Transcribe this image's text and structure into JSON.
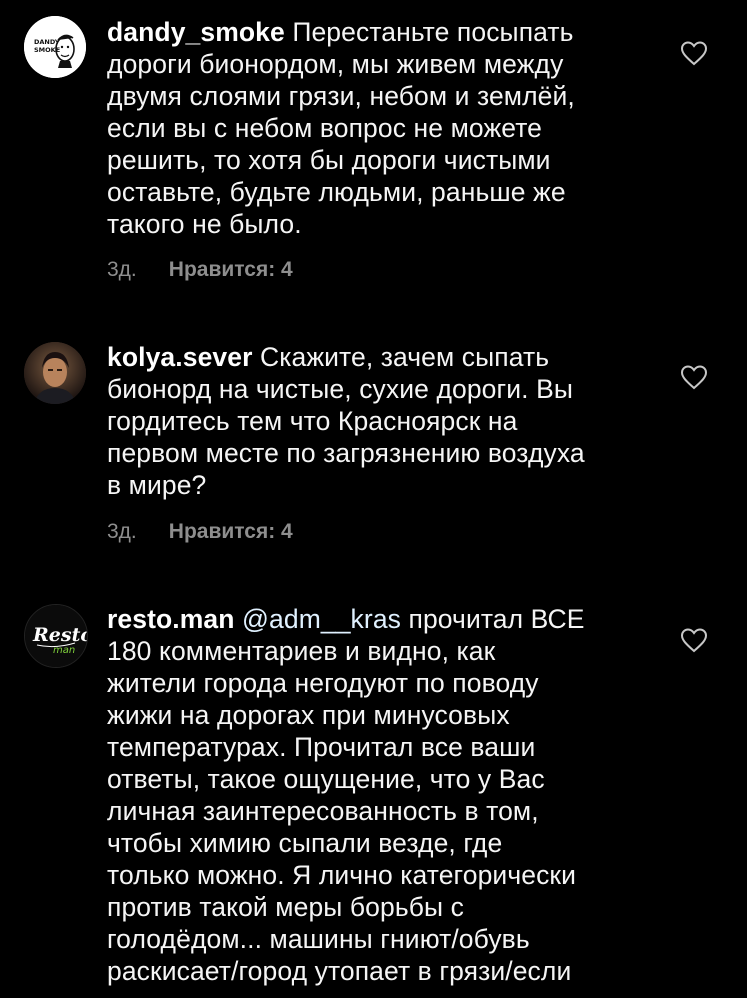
{
  "comments": [
    {
      "username": "dandy_smoke",
      "avatar_text": "DANDY SMOKE",
      "lines": [
        "Перестаньте посыпать",
        "дороги бионордом, мы живем между",
        "двумя слоями грязи, небом и землёй,",
        "если вы с небом вопрос не можете",
        "решить, то хотя бы дороги чистыми",
        "оставьте, будьте людьми, раньше же",
        "такого не было."
      ],
      "time": "3д.",
      "likes": "Нравится: 4",
      "icon": "heart-outline-icon"
    },
    {
      "username": "kolya.sever",
      "lines": [
        "Скажите,  зачем сыпать",
        "бионорд на чистые, сухие дороги. Вы",
        "гордитесь тем что Красноярск на",
        "первом месте по загрязнению воздуха",
        "в мире?"
      ],
      "time": "3д.",
      "likes": "Нравится: 4",
      "icon": "heart-outline-icon"
    },
    {
      "username": "resto.man",
      "avatar_text": "Resto man",
      "mention": "@adm__kras",
      "lines": [
        "прочитал ВСЕ",
        "180 комментариев и видно, как",
        "жители города негодуют по поводу",
        "жижи на дорогах при минусовых",
        "температурах. Прочитал все ваши",
        "ответы, такое ощущение, что у Вас",
        "личная заинтересованность в том,",
        "чтобы химию сыпали везде, где",
        "только можно. Я лично категорически",
        "против такой меры борьбы с",
        "голодёдом... машины гниют/обувь",
        "раскисает/город утопает в грязи/если"
      ],
      "icon": "heart-outline-icon"
    }
  ],
  "colors": {
    "background": "#000000",
    "text": "#f5f5f5",
    "secondary": "#8e8e8e",
    "mention": "#e0f1ff"
  }
}
